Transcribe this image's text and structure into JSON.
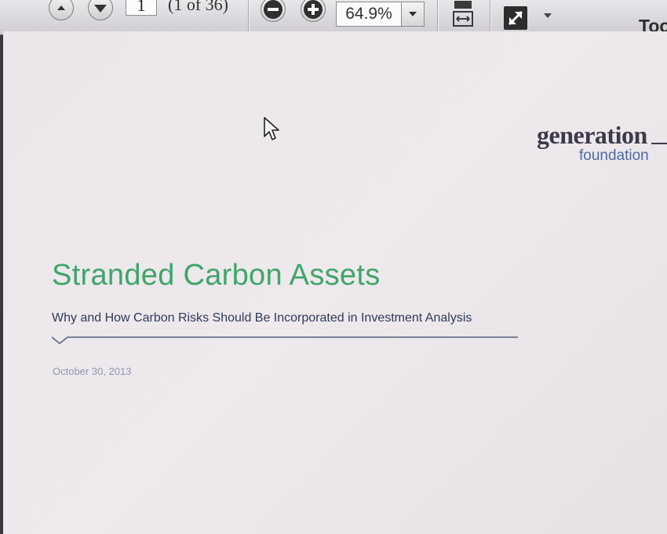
{
  "toolbar": {
    "page_number": "1",
    "page_count": "(1 of 36)",
    "zoom": "64.9%",
    "tools_label": "Too"
  },
  "document": {
    "logo_main": "generation",
    "logo_sub": "foundation",
    "title": "Stranded Carbon Assets",
    "subtitle": "Why and How Carbon Risks Should Be Incorporated in Investment Analysis",
    "date": "October 30, 2013"
  },
  "colors": {
    "title_green": "#3fa56b",
    "logo_blue": "#4d6aa3",
    "rule_blue": "#55617e"
  },
  "icons": [
    "page-up-icon",
    "page-down-icon",
    "zoom-out-icon",
    "zoom-in-icon",
    "chevron-down-icon",
    "fit-page-icon",
    "expand-icon",
    "cursor-icon"
  ]
}
